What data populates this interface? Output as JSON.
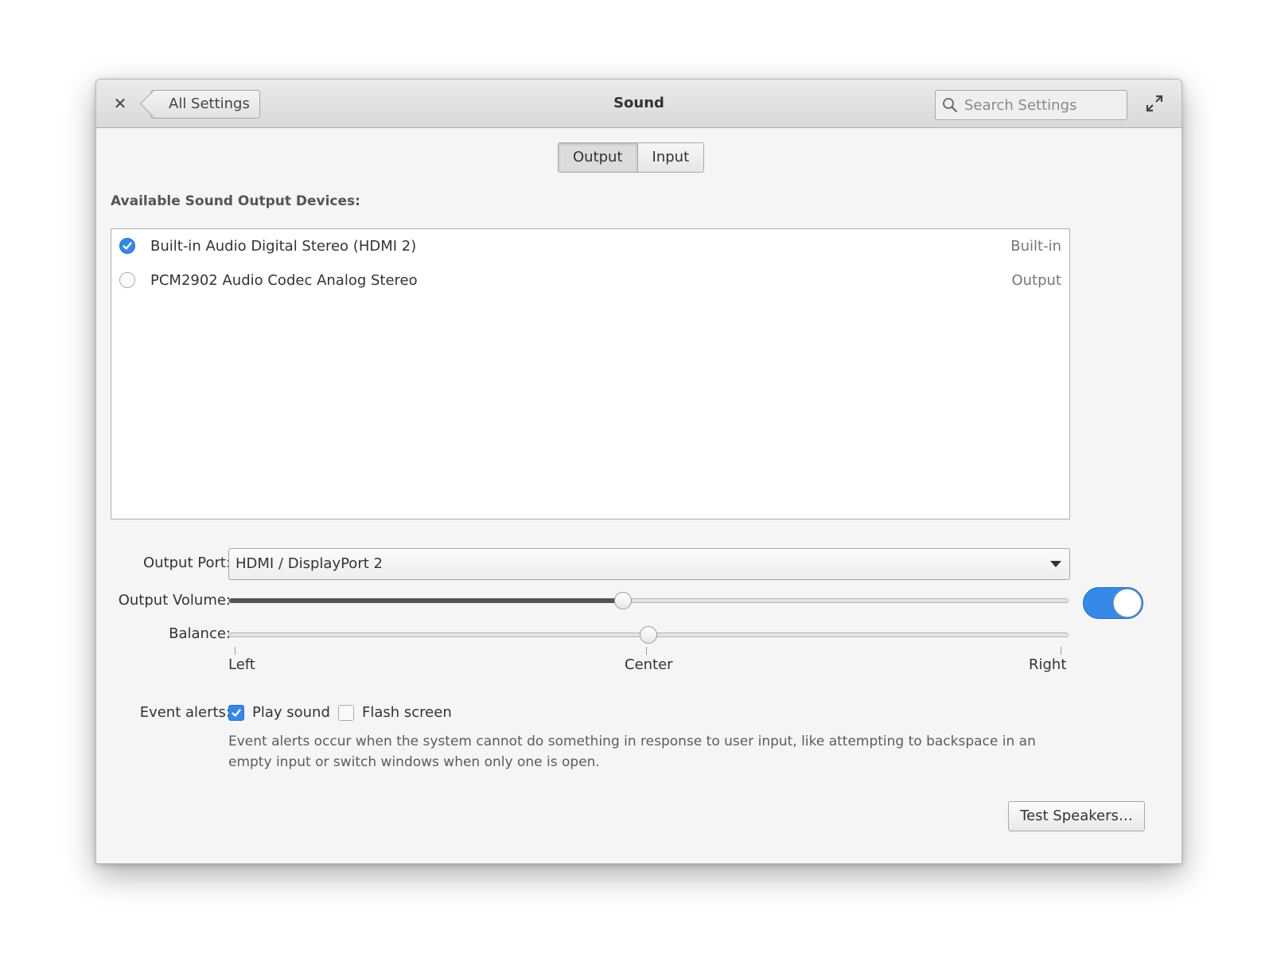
{
  "window": {
    "title": "Sound",
    "back_label": "All Settings",
    "search_placeholder": "Search Settings"
  },
  "icons": {
    "close": "close-icon",
    "search": "search-icon",
    "expand": "maximize-icon"
  },
  "tabs": [
    {
      "label": "Output",
      "active": true
    },
    {
      "label": "Input",
      "active": false
    }
  ],
  "devices_section": {
    "title": "Available Sound Output Devices:",
    "devices": [
      {
        "name": "Built-in Audio Digital Stereo (HDMI 2)",
        "type": "Built-in",
        "selected": true
      },
      {
        "name": "PCM2902 Audio Codec Analog Stereo",
        "type": "Output",
        "selected": false
      }
    ]
  },
  "output_port": {
    "label": "Output Port:",
    "value": "HDMI / DisplayPort 2"
  },
  "volume": {
    "label": "Output Volume:",
    "level_fraction": 0.47,
    "enabled": true
  },
  "balance": {
    "label": "Balance:",
    "level_fraction": 0.5,
    "marks": [
      "Left",
      "Center",
      "Right"
    ]
  },
  "event_alerts": {
    "label": "Event alerts:",
    "play_sound": {
      "label": "Play sound",
      "checked": true
    },
    "flash_screen": {
      "label": "Flash screen",
      "checked": false
    },
    "help": "Event alerts occur when the system cannot do something in response to user input, like attempting to backspace in an empty input or switch windows when only one is open."
  },
  "test_button": {
    "label": "Test Speakers…"
  },
  "colors": {
    "accent": "#3689e6",
    "window_bg": "#f5f5f5",
    "list_bg": "#ffffff",
    "slider_fill": "#555555"
  }
}
